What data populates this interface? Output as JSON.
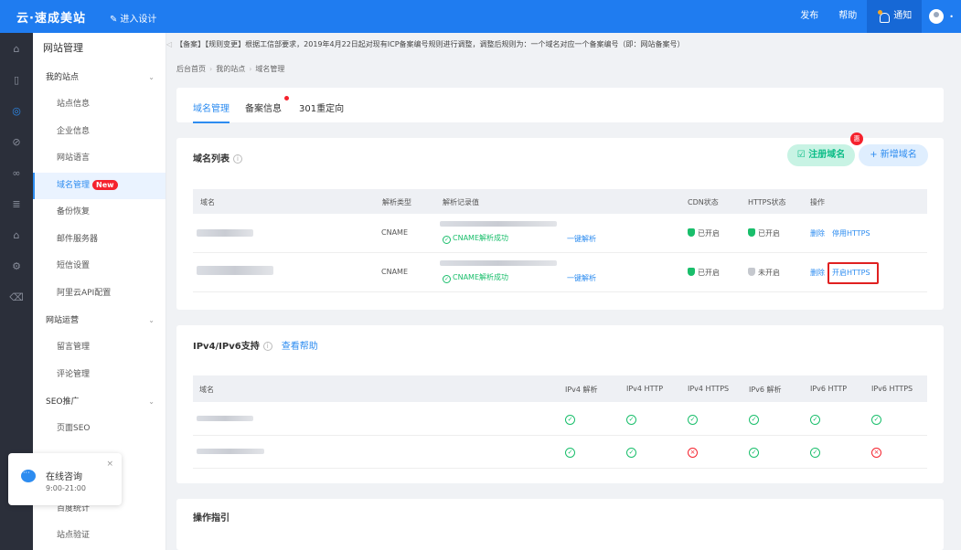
{
  "topbar": {
    "logo": "云·速成美站",
    "enter_design": "进入设计",
    "nav": {
      "publish": "发布",
      "help": "帮助",
      "notice": "通知"
    },
    "colors": {
      "bar": "#1f7cf0",
      "notice_bg": "#1668d6"
    }
  },
  "icon_rail": [
    "home-icon",
    "pages-icon",
    "site-icon",
    "compass-icon",
    "link-icon",
    "list-icon",
    "shop-icon",
    "settings-icon",
    "trash-icon"
  ],
  "sidebar": {
    "title": "网站管理",
    "groups": [
      {
        "label": "我的站点",
        "items": [
          "站点信息",
          "企业信息",
          "网站语言",
          "域名管理",
          "备份恢复",
          "邮件服务器",
          "短信设置",
          "阿里云API配置"
        ]
      },
      {
        "label": "网站运营",
        "items": [
          "留言管理",
          "评论管理"
        ]
      },
      {
        "label": "SEO推广",
        "items": [
          "页面SEO"
        ]
      }
    ],
    "more_items": [
      "百度统计",
      "站点验证"
    ],
    "new_badge": "New",
    "active_item": "域名管理"
  },
  "notice": "【备案】【规则变更】根据工信部要求，2019年4月22日起对现有ICP备案编号规则进行调整，调整后规则为：一个域名对应一个备案编号（即：网站备案号）",
  "breadcrumb": [
    "后台首页",
    "我的站点",
    "域名管理"
  ],
  "tabs": [
    "域名管理",
    "备案信息",
    "301重定向"
  ],
  "domain_list": {
    "title": "域名列表",
    "register_btn": "注册域名",
    "new_btn": "+ 新增域名",
    "hot_badge": "惠",
    "headers": [
      "域名",
      "解析类型",
      "解析记录值",
      "CDN状态",
      "HTTPS状态",
      "操作"
    ],
    "rows": [
      {
        "type": "CNAME",
        "record_status": "CNAME解析成功",
        "one_click": "一键解析",
        "cdn": "已开启",
        "https": "已开启",
        "https_on": true,
        "delete": "删除",
        "action": "停用HTTPS"
      },
      {
        "type": "CNAME",
        "record_status": "CNAME解析成功",
        "one_click": "一键解析",
        "cdn": "已开启",
        "https": "未开启",
        "https_on": false,
        "delete": "删除",
        "action": "开启HTTPS",
        "highlighted": true
      }
    ]
  },
  "ipv": {
    "title": "IPv4/IPv6支持",
    "help": "查看帮助",
    "headers": [
      "域名",
      "IPv4 解析",
      "IPv4 HTTP",
      "IPv4 HTTPS",
      "IPv6 解析",
      "IPv6 HTTP",
      "IPv6 HTTPS"
    ],
    "rows": [
      [
        true,
        true,
        true,
        true,
        true,
        true
      ],
      [
        true,
        true,
        false,
        true,
        true,
        false
      ]
    ]
  },
  "guide": {
    "title": "操作指引"
  },
  "chat": {
    "title": "在线咨询",
    "hours": "9:00-21:00",
    "close": "×"
  }
}
